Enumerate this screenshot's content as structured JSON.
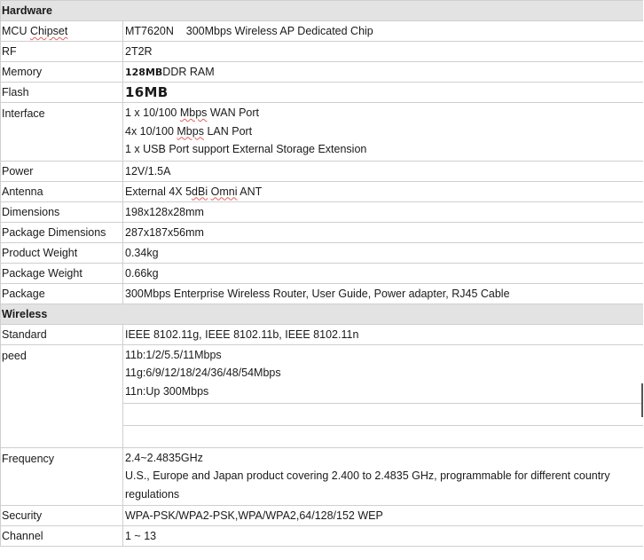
{
  "sections": {
    "hardware": "Hardware",
    "wireless": "Wireless"
  },
  "hardware": {
    "mcu": {
      "label_pre": "MCU ",
      "label_sq": "Chipset",
      "value": "MT7620N    300Mbps Wireless AP Dedicated Chip"
    },
    "rf": {
      "label": "RF",
      "value": "2T2R"
    },
    "memory": {
      "label": "Memory",
      "value_bold": "128MB",
      "value_rest": "DDR RAM"
    },
    "flash": {
      "label": "Flash",
      "value": "16MB"
    },
    "interface": {
      "label": "Interface",
      "line1_pre": "1 x 10/100 ",
      "line1_sq": "Mbps",
      "line1_post": " WAN Port",
      "line2_pre": "4x 10/100 ",
      "line2_sq": "Mbps",
      "line2_post": " LAN Port",
      "line3": "1 x USB Port support External Storage Extension"
    },
    "power": {
      "label": "Power",
      "value": "12V/1.5A"
    },
    "antenna": {
      "label": "Antenna",
      "value_pre": "External 4X 5",
      "value_sq1": "dBi",
      "value_mid": " ",
      "value_sq2": "Omni",
      "value_post": " ANT"
    },
    "dimensions": {
      "label": "Dimensions",
      "value": "198x128x28mm"
    },
    "package_dimensions": {
      "label": "Package Dimensions",
      "value": "287x187x56mm"
    },
    "product_weight": {
      "label": "Product Weight",
      "value": "0.34kg"
    },
    "package_weight": {
      "label": "Package Weight",
      "value": "0.66kg"
    },
    "package": {
      "label": "Package",
      "value": "300Mbps Enterprise Wireless Router, User Guide, Power adapter, RJ45 Cable"
    }
  },
  "wireless": {
    "standard": {
      "label": "Standard",
      "value": "IEEE 8102.11g, IEEE 8102.11b, IEEE 8102.11n"
    },
    "speed": {
      "label": "peed",
      "line1": "11b:1/2/5.5/11Mbps",
      "line2": "11g:6/9/12/18/24/36/48/54Mbps",
      "line3": "11n:Up 300Mbps"
    },
    "frequency": {
      "label": "Frequency",
      "line1": "2.4~2.4835GHz",
      "line2": "U.S., Europe and Japan product covering 2.400 to 2.4835 GHz, programmable for different country",
      "line3": "regulations"
    },
    "security": {
      "label": "Security",
      "value": "WPA-PSK/WPA2-PSK,WPA/WPA2,64/128/152 WEP"
    },
    "channel": {
      "label": "Channel",
      "value": "1 ~ 13"
    }
  }
}
